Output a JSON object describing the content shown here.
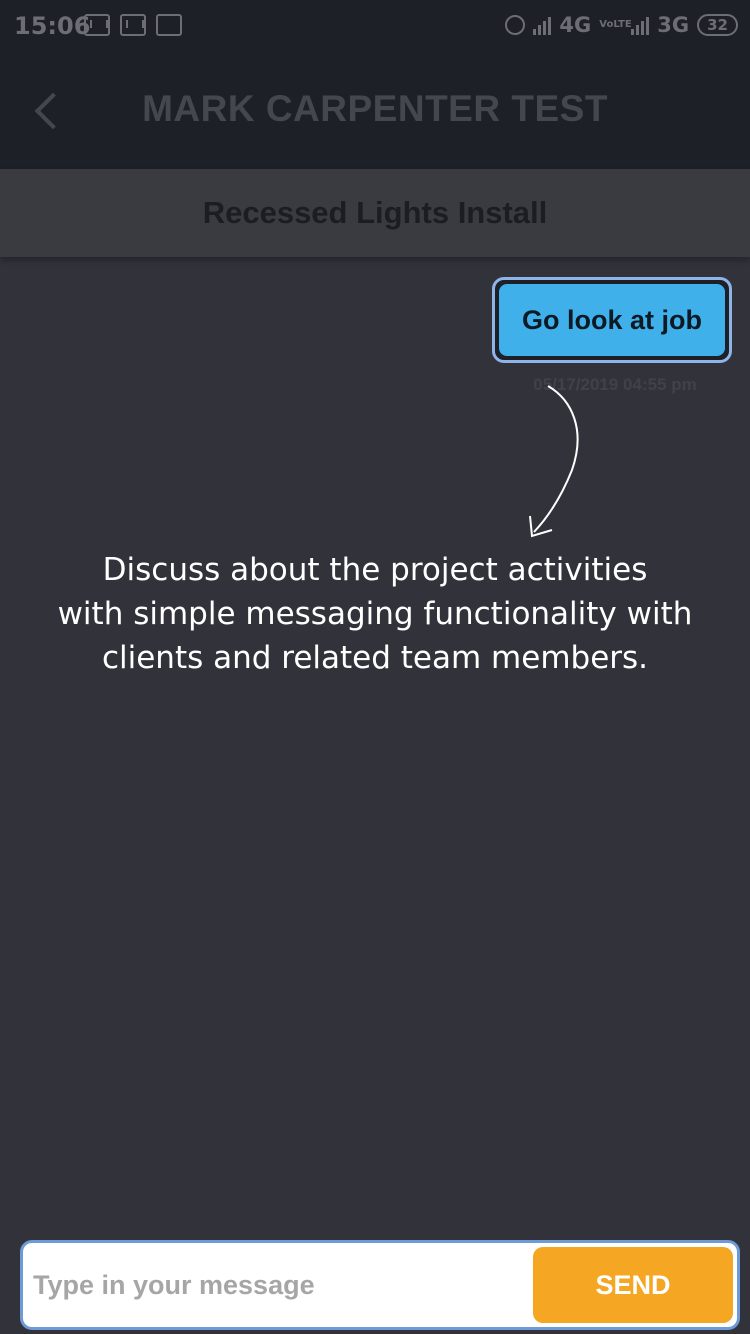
{
  "status_bar": {
    "time": "15:06",
    "network_1": "4G",
    "volte_label": "VoLTE",
    "network_2": "3G",
    "battery": "32"
  },
  "app_bar": {
    "title": "MARK CARPENTER TEST"
  },
  "sub_header": {
    "title": "Recessed Lights Install"
  },
  "messages": [
    {
      "text": "Go look at job",
      "timestamp": "05/17/2019 04:55 pm",
      "bubble_color": "#3fb0ea"
    }
  ],
  "caption": {
    "line1": "Discuss about the project activities",
    "line2": "with simple messaging functionality with",
    "line3": "clients and related team members."
  },
  "composer": {
    "placeholder": "Type in your message",
    "send_label": "SEND",
    "send_color": "#f5a623"
  }
}
